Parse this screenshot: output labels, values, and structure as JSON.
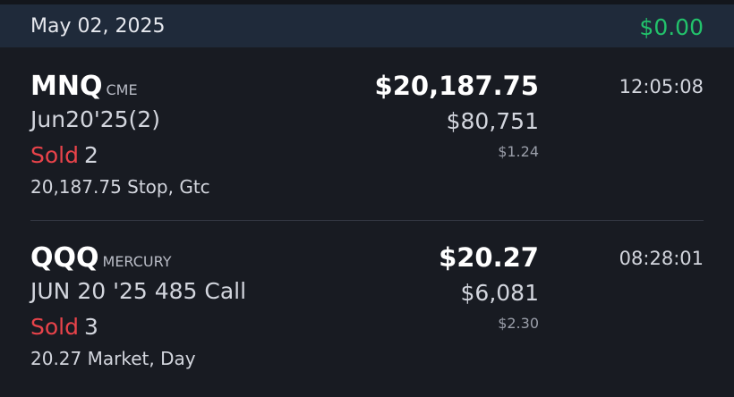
{
  "header": {
    "date": "May 02, 2025",
    "total": "$0.00"
  },
  "orders": [
    {
      "symbol": "MNQ",
      "exchange": "CME",
      "contract": "Jun20'25(2)",
      "side": "Sold",
      "quantity": "2",
      "detail": "20,187.75 Stop, Gtc",
      "price": "$20,187.75",
      "notional": "$80,751",
      "fee": "$1.24",
      "time": "12:05:08"
    },
    {
      "symbol": "QQQ",
      "exchange": "MERCURY",
      "contract": "JUN 20 '25 485 Call",
      "side": "Sold",
      "quantity": "3",
      "detail": "20.27 Market, Day",
      "price": "$20.27",
      "notional": "$6,081",
      "fee": "$2.30",
      "time": "08:28:01"
    }
  ],
  "colors": {
    "background": "#181b22",
    "header_background": "#1f2a3a",
    "positive": "#22c26b",
    "sell": "#e8434a"
  }
}
